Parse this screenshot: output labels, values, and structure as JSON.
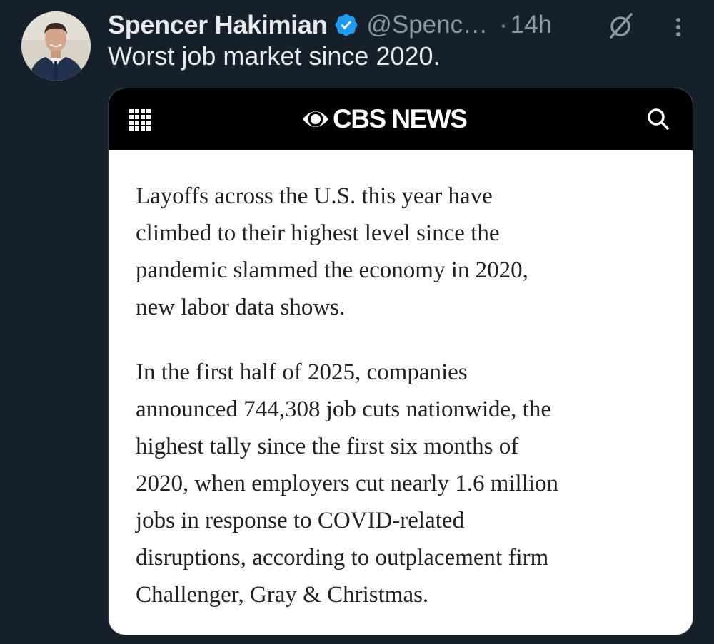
{
  "tweet": {
    "author": {
      "display_name": "Spencer Hakimian",
      "handle": "@Spenc…",
      "verified": true,
      "avatar_icon": "avatar"
    },
    "separator": "·",
    "time": "14h",
    "text": "Worst job market since 2020.",
    "icons": {
      "grok": "grok-icon",
      "more": "more-icon",
      "verified": "verified-badge-icon"
    }
  },
  "media": {
    "site_name": "CBS NEWS",
    "icons": {
      "menu": "grid-menu-icon",
      "logo": "cbs-eye-icon",
      "search": "search-icon"
    },
    "paragraphs": [
      "Layoffs across the U.S. this year have\nclimbed to their highest level since the\npandemic slammed the economy in 2020,\nnew labor data shows.",
      "In the first half of 2025, companies\nannounced 744,308 job cuts nationwide, the\nhighest tally since the first six months of\n2020, when employers cut nearly 1.6 million\njobs in response to COVID-related\ndisruptions, according to outplacement firm\nChallenger, Gray & Christmas."
    ]
  },
  "colors": {
    "background": "#15202b",
    "primary_text": "#e7e9ea",
    "secondary_text": "#8b98a5",
    "verified_blue": "#1d9bf0",
    "cbs_bar": "#000000"
  }
}
